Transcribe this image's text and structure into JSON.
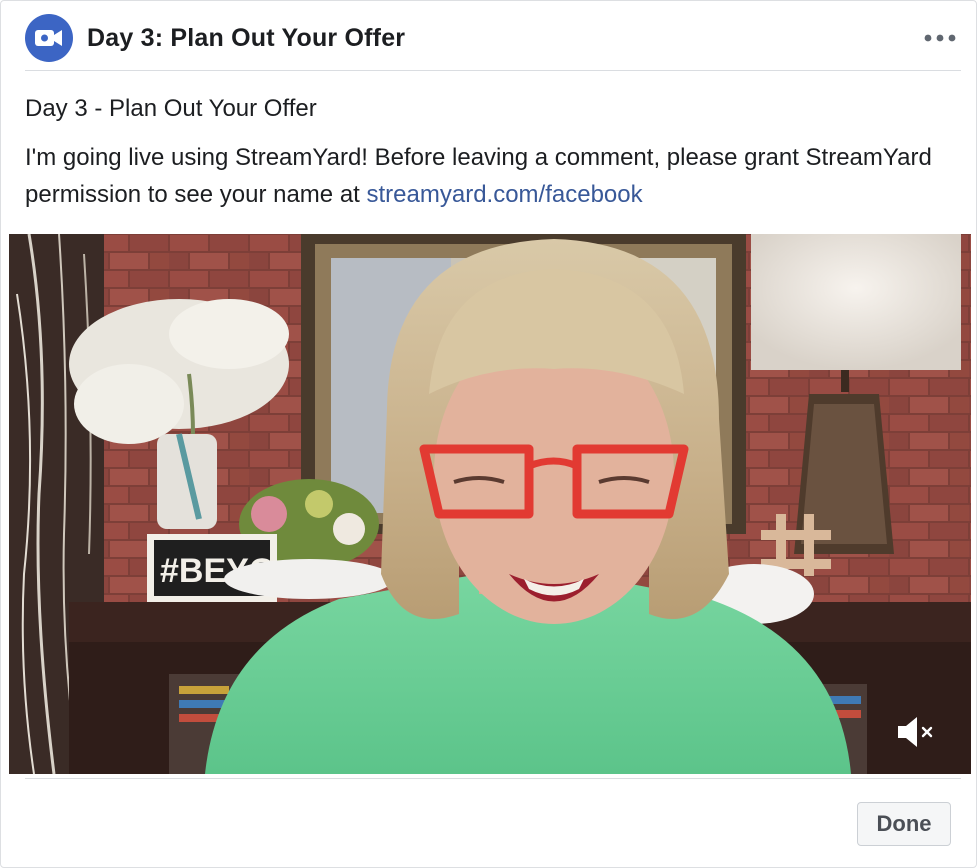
{
  "header": {
    "title": "Day 3: Plan Out Your Offer",
    "badge_icon": "video-camera-icon",
    "more_icon": "more-options-icon",
    "badge_color": "#3c65c4"
  },
  "post": {
    "title": "Day 3 - Plan Out Your Offer",
    "message": "I'm going live using StreamYard! Before leaving a comment, please grant StreamYard permission to see your name at",
    "link_text": "streamyard.com/facebook",
    "link_color": "#385898"
  },
  "video": {
    "sign_text": "#BEYO",
    "mute_icon": "speaker-muted-icon"
  },
  "footer": {
    "done_label": "Done"
  }
}
